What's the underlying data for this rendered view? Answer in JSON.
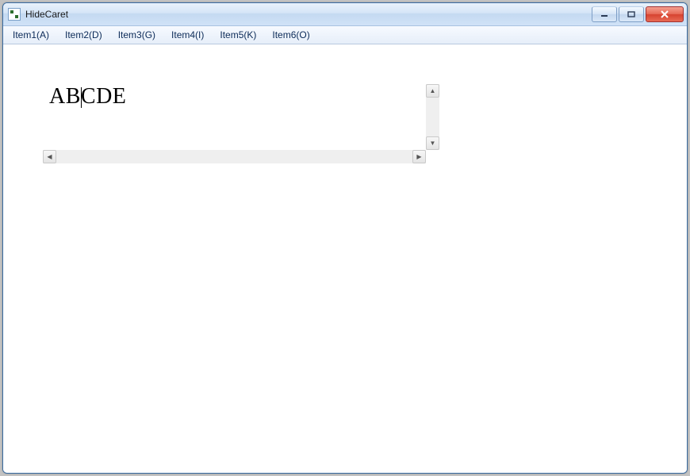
{
  "window": {
    "title": "HideCaret"
  },
  "menu": {
    "items": [
      {
        "label": "Item1(A)"
      },
      {
        "label": "Item2(D)"
      },
      {
        "label": "Item3(G)"
      },
      {
        "label": "Item4(I)"
      },
      {
        "label": "Item5(K)"
      },
      {
        "label": "Item6(O)"
      }
    ]
  },
  "editor": {
    "text": "ABCDE",
    "caret_index": 2
  }
}
